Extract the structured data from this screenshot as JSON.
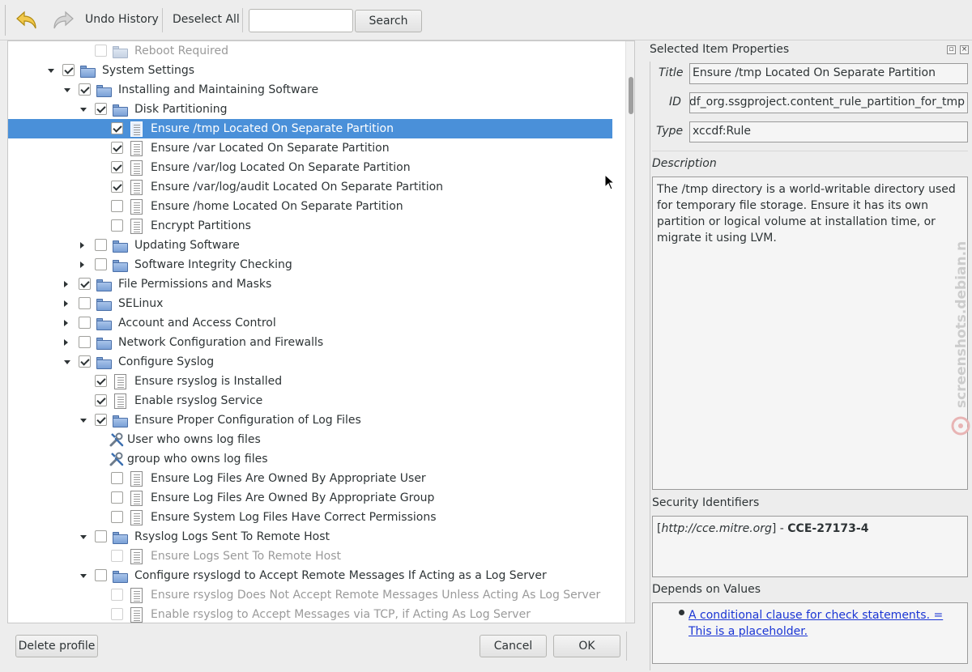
{
  "toolbar": {
    "undo_history": "Undo History",
    "deselect_all": "Deselect All",
    "search_value": "",
    "search_button": "Search"
  },
  "tree": {
    "rows": [
      {
        "label": "Reboot Required",
        "level": 2,
        "kind": "folder",
        "checked": false,
        "dim": true,
        "expander": "none"
      },
      {
        "label": "System Settings",
        "level": 0,
        "kind": "folder",
        "checked": true,
        "dim": false,
        "expander": "down"
      },
      {
        "label": "Installing and Maintaining Software",
        "level": 1,
        "kind": "folder",
        "checked": true,
        "dim": false,
        "expander": "down"
      },
      {
        "label": "Disk Partitioning",
        "level": 2,
        "kind": "folder",
        "checked": true,
        "dim": false,
        "expander": "down"
      },
      {
        "label": "Ensure /tmp Located On Separate Partition",
        "level": 3,
        "kind": "doc",
        "checked": true,
        "dim": false,
        "expander": "none",
        "selected": true
      },
      {
        "label": "Ensure /var Located On Separate Partition",
        "level": 3,
        "kind": "doc",
        "checked": true,
        "dim": false,
        "expander": "none"
      },
      {
        "label": "Ensure /var/log Located On Separate Partition",
        "level": 3,
        "kind": "doc",
        "checked": true,
        "dim": false,
        "expander": "none"
      },
      {
        "label": "Ensure /var/log/audit Located On Separate Partition",
        "level": 3,
        "kind": "doc",
        "checked": true,
        "dim": false,
        "expander": "none"
      },
      {
        "label": "Ensure /home Located On Separate Partition",
        "level": 3,
        "kind": "doc",
        "checked": false,
        "dim": false,
        "expander": "none"
      },
      {
        "label": "Encrypt Partitions",
        "level": 3,
        "kind": "doc",
        "checked": false,
        "dim": false,
        "expander": "none"
      },
      {
        "label": "Updating Software",
        "level": 2,
        "kind": "folder",
        "checked": false,
        "dim": false,
        "expander": "right"
      },
      {
        "label": "Software Integrity Checking",
        "level": 2,
        "kind": "folder",
        "checked": false,
        "dim": false,
        "expander": "right"
      },
      {
        "label": "File Permissions and Masks",
        "level": 1,
        "kind": "folder",
        "checked": true,
        "dim": false,
        "expander": "right"
      },
      {
        "label": "SELinux",
        "level": 1,
        "kind": "folder",
        "checked": false,
        "dim": false,
        "expander": "right"
      },
      {
        "label": "Account and Access Control",
        "level": 1,
        "kind": "folder",
        "checked": false,
        "dim": false,
        "expander": "right"
      },
      {
        "label": "Network Configuration and Firewalls",
        "level": 1,
        "kind": "folder",
        "checked": false,
        "dim": false,
        "expander": "right"
      },
      {
        "label": "Configure Syslog",
        "level": 1,
        "kind": "folder",
        "checked": true,
        "dim": false,
        "expander": "down"
      },
      {
        "label": "Ensure rsyslog is Installed",
        "level": 2,
        "kind": "doc",
        "checked": true,
        "dim": false,
        "expander": "none"
      },
      {
        "label": "Enable rsyslog Service",
        "level": 2,
        "kind": "doc",
        "checked": true,
        "dim": false,
        "expander": "none"
      },
      {
        "label": "Ensure Proper Configuration of Log Files",
        "level": 2,
        "kind": "folder",
        "checked": true,
        "dim": false,
        "expander": "down"
      },
      {
        "label": "User who owns log files",
        "level": 3,
        "kind": "tool",
        "checked": null,
        "dim": false,
        "expander": "none"
      },
      {
        "label": "group who owns log files",
        "level": 3,
        "kind": "tool",
        "checked": null,
        "dim": false,
        "expander": "none"
      },
      {
        "label": "Ensure Log Files Are Owned By Appropriate User",
        "level": 3,
        "kind": "doc",
        "checked": false,
        "dim": false,
        "expander": "none"
      },
      {
        "label": "Ensure Log Files Are Owned By Appropriate Group",
        "level": 3,
        "kind": "doc",
        "checked": false,
        "dim": false,
        "expander": "none"
      },
      {
        "label": "Ensure System Log Files Have Correct Permissions",
        "level": 3,
        "kind": "doc",
        "checked": false,
        "dim": false,
        "expander": "none"
      },
      {
        "label": "Rsyslog Logs Sent To Remote Host",
        "level": 2,
        "kind": "folder",
        "checked": false,
        "dim": false,
        "expander": "down"
      },
      {
        "label": "Ensure Logs Sent To Remote Host",
        "level": 3,
        "kind": "doc",
        "checked": false,
        "dim": true,
        "expander": "none"
      },
      {
        "label": "Configure rsyslogd to Accept Remote Messages If Acting as a Log Server",
        "level": 2,
        "kind": "folder",
        "checked": false,
        "dim": false,
        "expander": "down"
      },
      {
        "label": "Ensure rsyslog Does Not Accept Remote Messages Unless Acting As Log Server",
        "level": 3,
        "kind": "doc",
        "checked": false,
        "dim": true,
        "expander": "none"
      },
      {
        "label": "Enable rsyslog to Accept Messages via TCP, if Acting As Log Server",
        "level": 3,
        "kind": "doc",
        "checked": false,
        "dim": true,
        "expander": "none"
      }
    ]
  },
  "props": {
    "header": "Selected Item Properties",
    "title_label": "Title",
    "title_value": "Ensure /tmp Located On Separate Partition",
    "id_label": "ID",
    "id_value": "xccdf_org.ssgproject.content_rule_partition_for_tmp",
    "type_label": "Type",
    "type_value": "xccdf:Rule",
    "description_label": "Description",
    "description": "The /tmp directory is a world-writable directory used for temporary file storage. Ensure it has its own partition or logical volume at installation time, or migrate it using LVM.",
    "security_label": "Security Identifiers",
    "security_uri": "http://cce.mitre.org",
    "security_sep": " - ",
    "security_id": "CCE-27173-4",
    "depends_label": "Depends on Values",
    "depends_link": "A conditional clause for check statements. = This is a placeholder."
  },
  "footer": {
    "delete_profile": "Delete profile",
    "cancel": "Cancel",
    "ok": "OK"
  },
  "watermark": "screenshots.debian.net"
}
